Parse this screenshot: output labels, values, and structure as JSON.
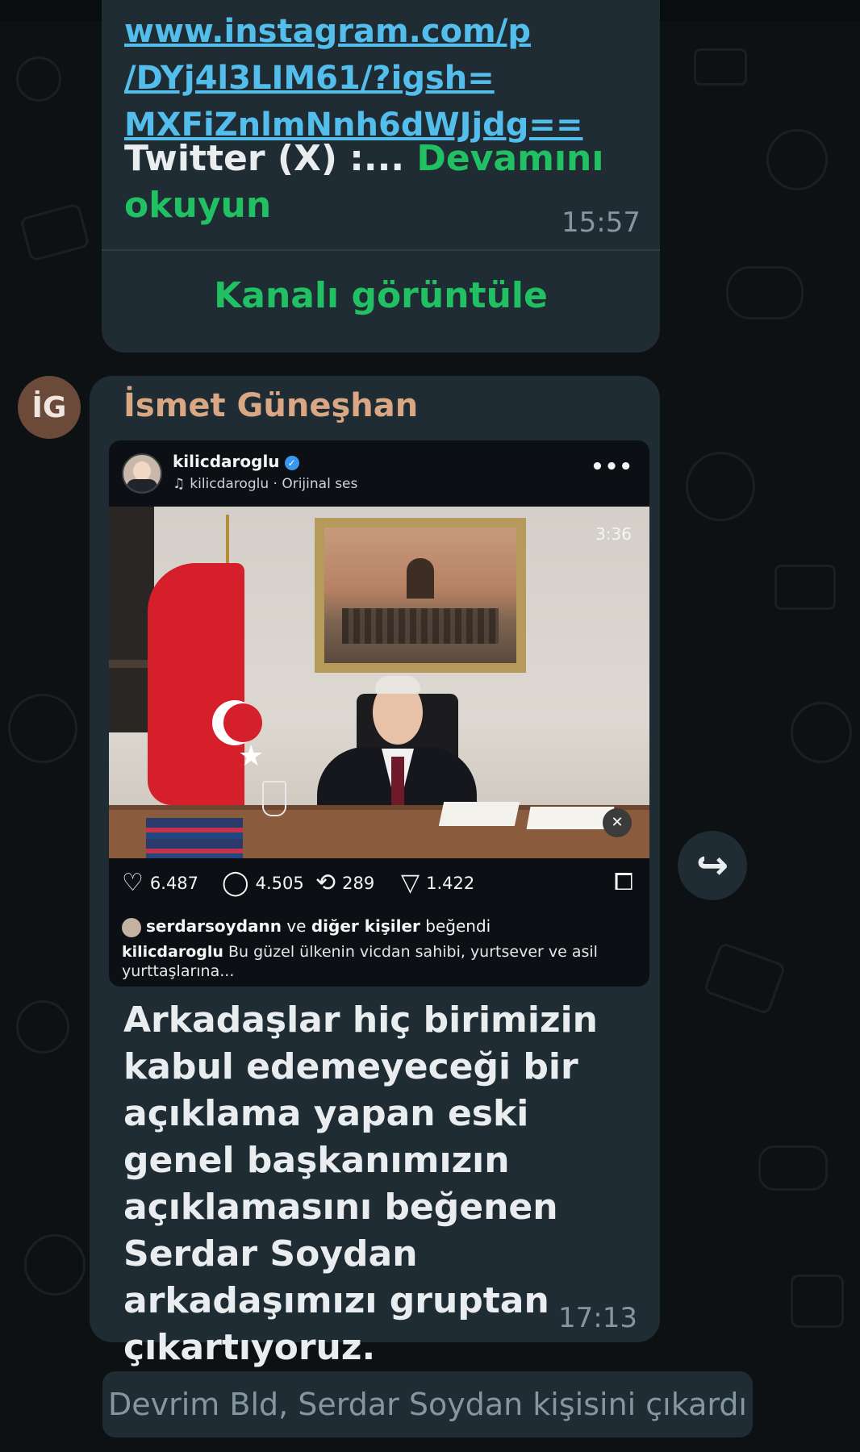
{
  "top_message": {
    "link_lines": [
      "www.instagram.com/p",
      "/DYj4l3LIM61/?igsh=",
      "MXFiZnlmNnh6dWJjdg=="
    ],
    "twitter_text": "Twitter (X) :...",
    "read_more": "Devamını okuyun",
    "time": "15:57",
    "channel_button": "Kanalı görüntüle"
  },
  "main_message": {
    "avatar_initials": "İG",
    "sender": "İsmet Güneşhan",
    "instagram": {
      "username": "kilicdaroglu",
      "verified_mark": "✓",
      "audio": "kilicdaroglu · Orijinal ses",
      "more_icon": "•••",
      "video_duration": "3:36",
      "likes": "6.487",
      "comments": "4.505",
      "reposts": "289",
      "shares": "1.422",
      "liked_by_user": "serdarsoydann",
      "liked_by_mid": "ve",
      "liked_by_others": "diğer kişiler",
      "liked_by_end": "beğendi",
      "caption_user": "kilicdaroglu",
      "caption_text": "Bu güzel ülkenin vicdan sahibi, yurtsever ve asil yurttaşlarına..."
    },
    "text": "Arkadaşlar hiç birimizin kabul edemeyeceği bir açıklama yapan eski genel başkanımızın açıklamasını beğenen Serdar Soydan arkadaşımızı gruptan çıkartıyoruz.",
    "time": "17:13"
  },
  "system_message": "Devrim Bld, Serdar Soydan kişisini çıkardı",
  "icons": {
    "heart": "♡",
    "comment": "◯",
    "repost": "⟲",
    "share": "▽",
    "bookmark": "⧠",
    "forward": "↪",
    "mute": "🔇",
    "music": "♫"
  },
  "colors": {
    "bubble": "#1f2c33",
    "link": "#53bdeb",
    "accent_green": "#21c063",
    "sender_name": "#d9a783"
  }
}
